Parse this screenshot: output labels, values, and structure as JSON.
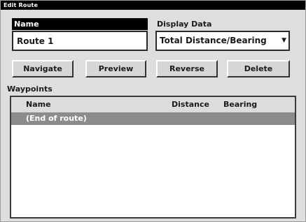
{
  "window": {
    "title": "Edit Route"
  },
  "name_field": {
    "label": "Name",
    "value": "Route 1"
  },
  "display_data": {
    "label": "Display Data",
    "selected": "Total Distance/Bearing"
  },
  "buttons": {
    "navigate": "Navigate",
    "preview": "Preview",
    "reverse": "Reverse",
    "delete": "Delete"
  },
  "waypoints": {
    "label": "Waypoints",
    "columns": [
      "Name",
      "Distance",
      "Bearing"
    ],
    "rows": [
      {
        "name": "(End of route)",
        "distance": "",
        "bearing": "",
        "selected": true
      }
    ]
  },
  "colors": {
    "title_bar": "#000000",
    "window_bg": "#dedede",
    "selected_row": "#8c8c8c"
  }
}
